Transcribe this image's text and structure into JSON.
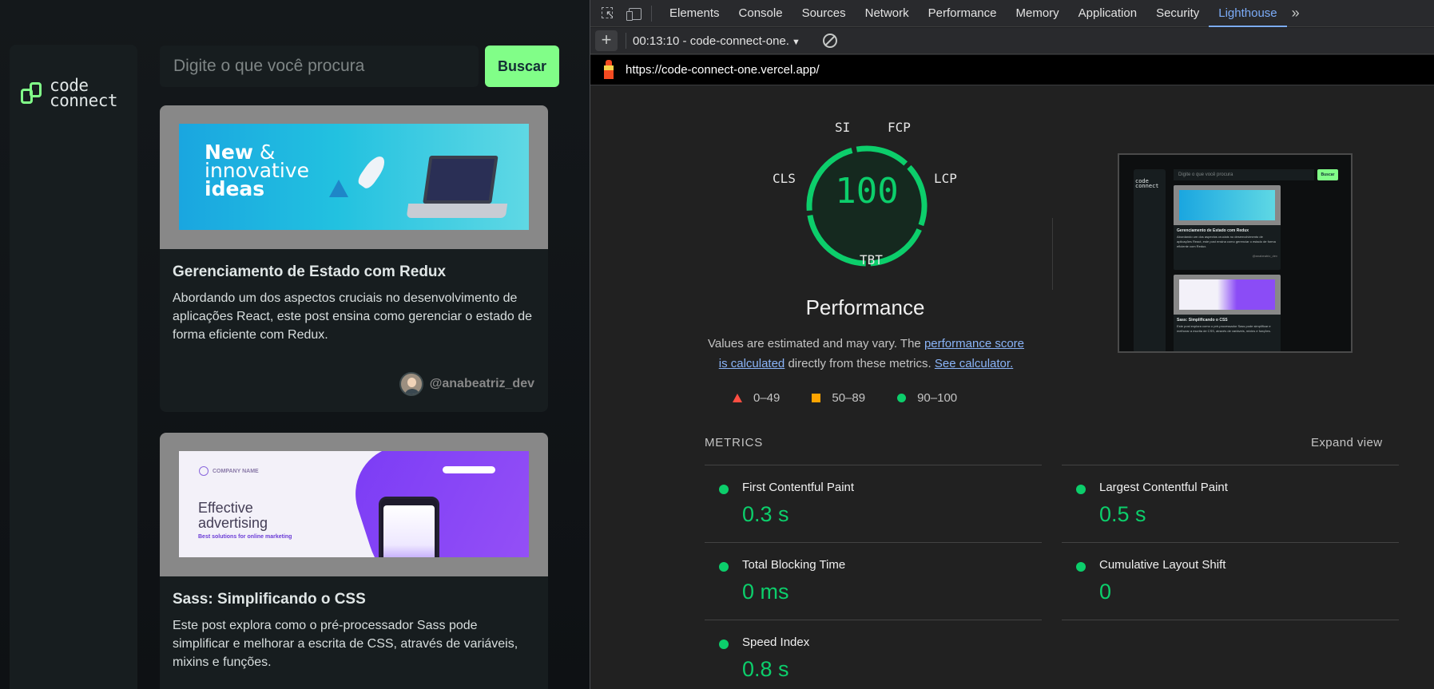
{
  "site": {
    "logo_top": "code",
    "logo_bottom": "connect",
    "search_placeholder": "Digite o que você procura",
    "search_button": "Buscar",
    "cards": [
      {
        "banner_title_1": "New",
        "banner_title_amp": " &",
        "banner_title_2": "innovative",
        "banner_title_3": "ideas",
        "title": "Gerenciamento de Estado com Redux",
        "text": "Abordando um dos aspectos cruciais no desenvolvimento de aplicações React, este post ensina como gerenciar o estado de forma eficiente com Redux.",
        "author": "@anabeatriz_dev"
      },
      {
        "banner_company": "COMPANY NAME",
        "banner_title_1": "Effective",
        "banner_title_2": "advertising",
        "banner_subtitle": "Best solutions for online marketing",
        "title": "Sass: Simplificando o CSS",
        "text": "Este post explora como o pré-processador Sass pode simplificar e melhorar a escrita de CSS, através de variáveis, mixins e funções."
      }
    ]
  },
  "devtools": {
    "tabs": [
      "Elements",
      "Console",
      "Sources",
      "Network",
      "Performance",
      "Memory",
      "Application",
      "Security",
      "Lighthouse"
    ],
    "active_tab": "Lighthouse",
    "more_tabs": "»",
    "report_selector": "00:13:10 - code-connect-one.",
    "url": "https://code-connect-one.vercel.app/"
  },
  "lighthouse": {
    "score": "100",
    "category": "Performance",
    "gauge_labels": {
      "si": "SI",
      "fcp": "FCP",
      "lcp": "LCP",
      "tbt": "TBT",
      "cls": "CLS"
    },
    "note_part1": "Values are estimated and may vary. The",
    "note_link1": "performance score is calculated",
    "note_part2": "directly from these metrics.",
    "note_link2": "See calculator.",
    "legend": {
      "fail": "0–49",
      "average": "50–89",
      "pass": "90–100"
    },
    "metrics_heading": "METRICS",
    "expand_view": "Expand view",
    "metrics": [
      {
        "name": "First Contentful Paint",
        "value": "0.3 s"
      },
      {
        "name": "Largest Contentful Paint",
        "value": "0.5 s"
      },
      {
        "name": "Total Blocking Time",
        "value": "0 ms"
      },
      {
        "name": "Cumulative Layout Shift",
        "value": "0"
      },
      {
        "name": "Speed Index",
        "value": "0.8 s"
      }
    ],
    "colors": {
      "pass": "#0cce6b",
      "average": "#ffa400",
      "fail": "#ff4e42"
    },
    "screenshot": {
      "search": "Digite o que você procura",
      "button": "Buscar",
      "card1_title": "Gerenciamento de Estado com Redux",
      "card1_text": "Abordando um dos aspectos cruciais no desenvolvimento de aplicações React, este post ensina como gerenciar o estado de forma eficiente com Redux.",
      "card1_author": "@anabeatriz_dev",
      "card2_title": "Sass: Simplificando o CSS",
      "card2_text": "Este post explora como o pré-processador Sass pode simplificar e melhorar a escrita de CSS, através de variáveis, mixins e funções."
    }
  }
}
